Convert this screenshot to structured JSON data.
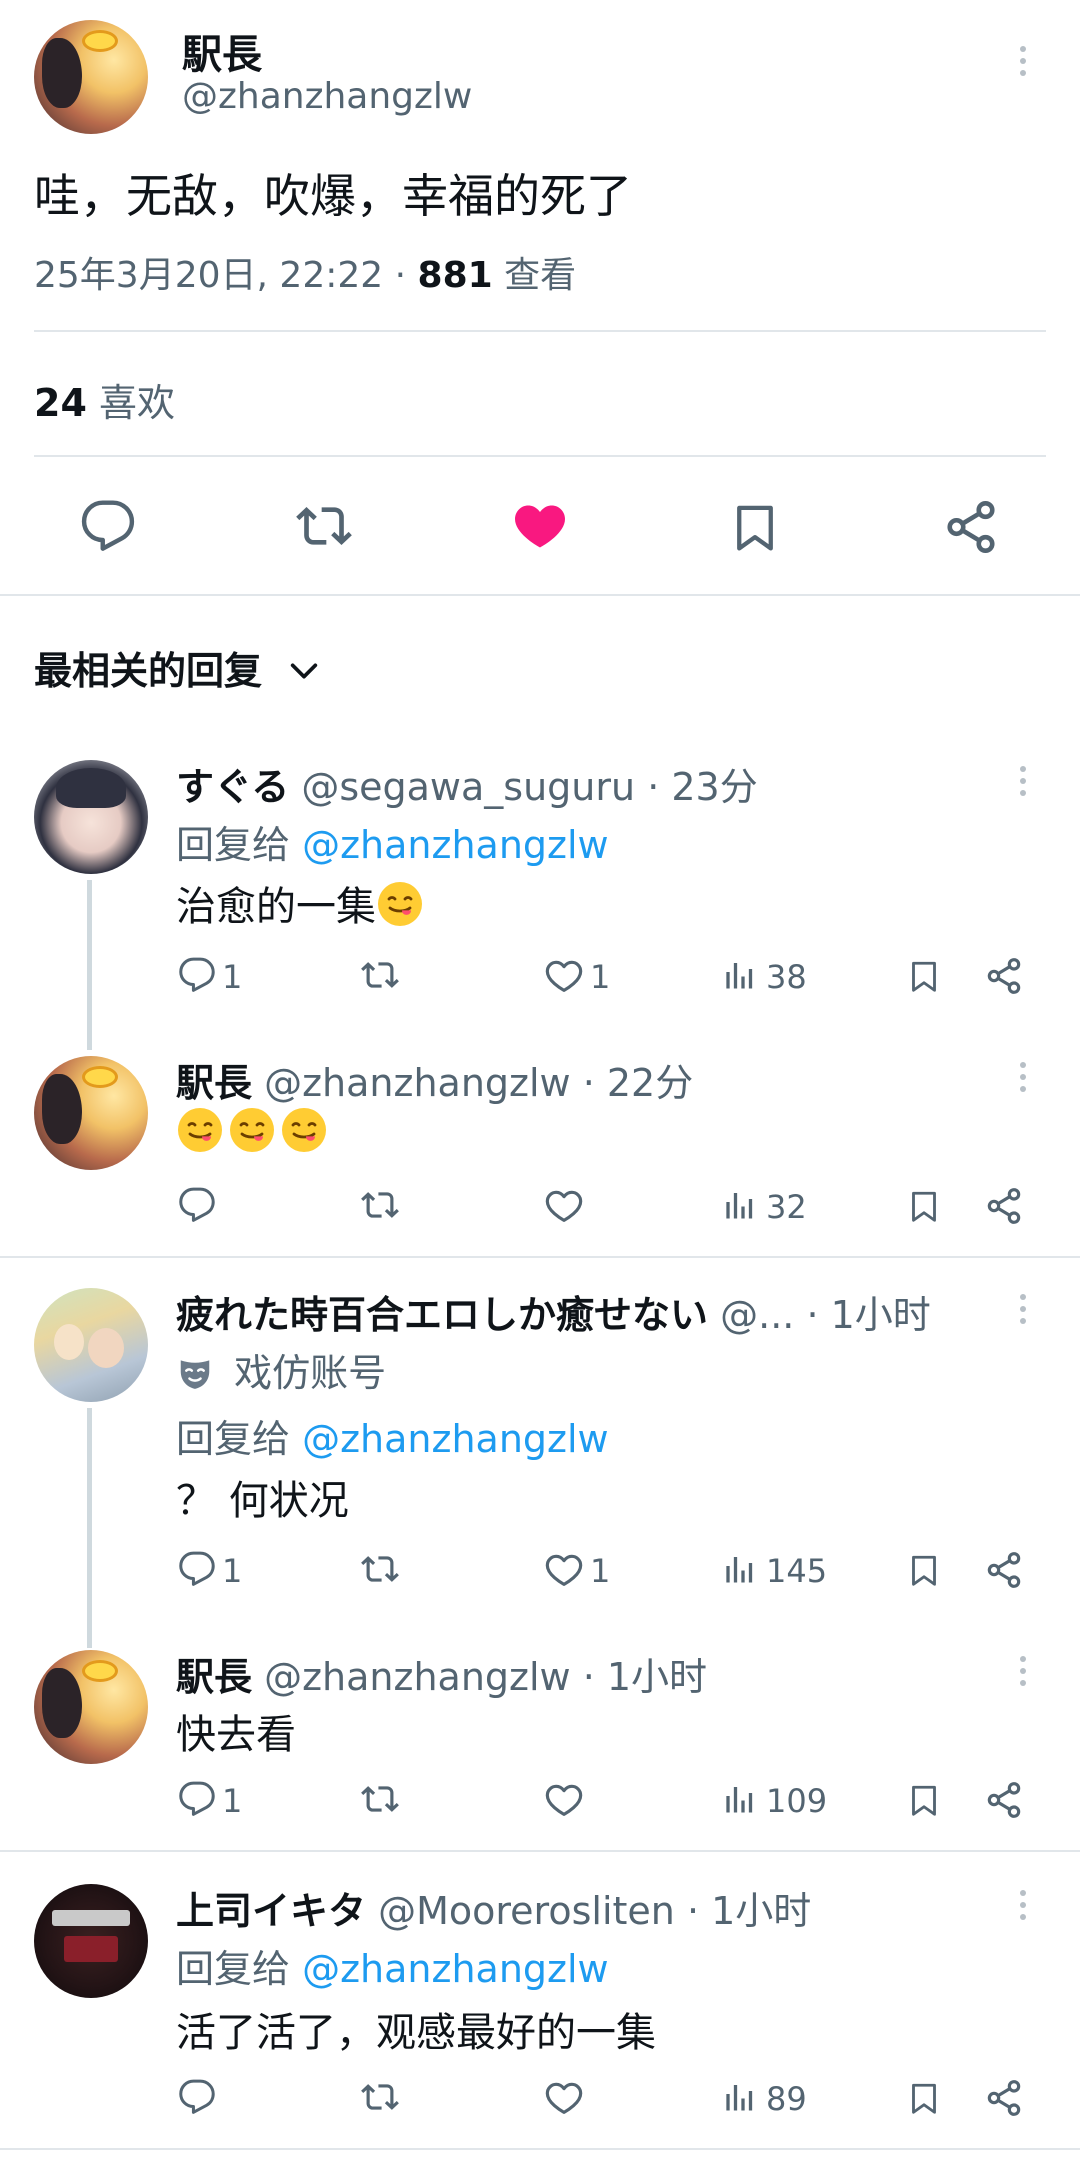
{
  "main_tweet": {
    "display_name": "駅長",
    "handle": "@zhanzhangzlw",
    "text": "哇，无敌，吹爆，幸福的死了",
    "timestamp": "25年3月20日, 22:22",
    "separator": "·",
    "views_count": "881",
    "views_label": "查看",
    "likes_count": "24",
    "likes_label": "喜欢",
    "liked": true,
    "like_color": "#f91880"
  },
  "replies_sort": {
    "label": "最相关的回复"
  },
  "replies": [
    {
      "display_name": "すぐる",
      "handle": "@segawa_suguru",
      "time": "· 23分",
      "reply_to_prefix": "回复给",
      "reply_to_handle": "@zhanzhangzlw",
      "text": "治愈的一集",
      "reply_count": "1",
      "retweet_count": "",
      "like_count": "1",
      "view_count": "38"
    },
    {
      "display_name": "駅長",
      "handle": "@zhanzhangzlw",
      "time": "· 22分",
      "text": "",
      "reply_count": "",
      "retweet_count": "",
      "like_count": "",
      "view_count": "32"
    },
    {
      "display_name": "疲れた時百合エロしか癒せない",
      "handle": "@...",
      "time": "· 1小时",
      "badge_label": "戏仿账号",
      "reply_to_prefix": "回复给",
      "reply_to_handle": "@zhanzhangzlw",
      "text": "？ 何状况",
      "reply_count": "1",
      "retweet_count": "",
      "like_count": "1",
      "view_count": "145"
    },
    {
      "display_name": "駅長",
      "handle": "@zhanzhangzlw",
      "time": "· 1小时",
      "text": "快去看",
      "reply_count": "1",
      "retweet_count": "",
      "like_count": "",
      "view_count": "109"
    },
    {
      "display_name": "上司イキタ",
      "handle": "@Moorerosliten",
      "time": "· 1小时",
      "reply_to_prefix": "回复给",
      "reply_to_handle": "@zhanzhangzlw",
      "text": "活了活了，观感最好的一集",
      "reply_count": "",
      "retweet_count": "",
      "like_count": "",
      "view_count": "89"
    }
  ],
  "colors": {
    "accent": "#1d9bf0",
    "text": "#0f1419",
    "secondary": "#536471",
    "like": "#f91880"
  },
  "icons": [
    "reply-icon",
    "retweet-icon",
    "heart-icon",
    "bookmark-icon",
    "share-icon",
    "views-icon",
    "more-icon",
    "chevron-down-icon",
    "parody-mask-icon",
    "yum-emoji"
  ]
}
